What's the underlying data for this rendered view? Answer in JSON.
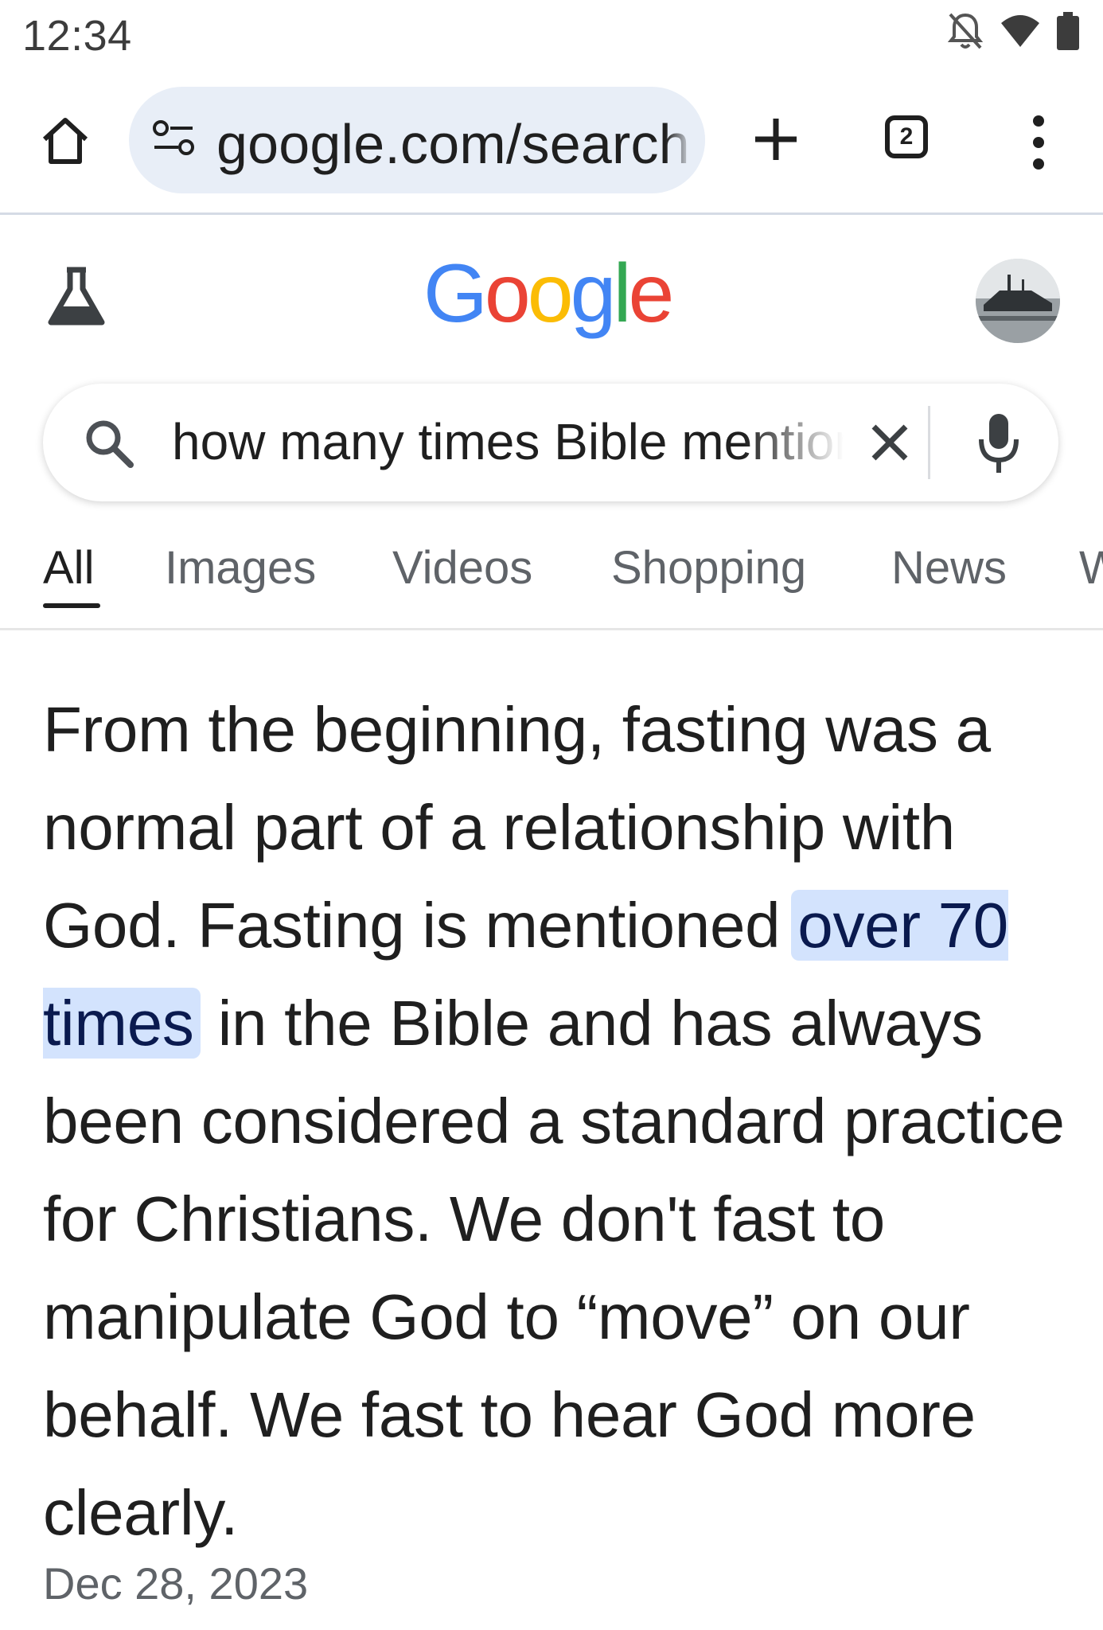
{
  "status_bar": {
    "time": "12:34",
    "icons": [
      "notifications-off-icon",
      "wifi-icon",
      "battery-icon"
    ]
  },
  "browser": {
    "url": "google.com/search",
    "tab_count": "2",
    "icons": [
      "home-icon",
      "site-settings-icon",
      "plus-icon",
      "tabs-icon",
      "more-vert-icon"
    ]
  },
  "google": {
    "logo_letters": [
      {
        "char": "G",
        "color": "#4285F4"
      },
      {
        "char": "o",
        "color": "#EA4335"
      },
      {
        "char": "o",
        "color": "#FBBC05"
      },
      {
        "char": "g",
        "color": "#4285F4"
      },
      {
        "char": "l",
        "color": "#34A853"
      },
      {
        "char": "e",
        "color": "#EA4335"
      }
    ]
  },
  "search": {
    "query": "how many times Bible mentions fasting"
  },
  "tabs": [
    "All",
    "Images",
    "Videos",
    "Shopping",
    "News",
    "W"
  ],
  "answer": {
    "before": "From the beginning, fasting was a normal part of a relationship with God. Fasting is mentioned ",
    "highlight": "over 70 times",
    "after": " in the Bible and has always been considered a standard practice for Christians. We don't fast to manipulate God to “move” on our behalf. We fast to hear God more clearly.",
    "date": "Dec 28, 2023"
  },
  "colors": {
    "omnibox_bg": "#e8eef7",
    "highlight_bg": "#d3e3fd",
    "text": "#1f1f1f",
    "muted": "#5f6368"
  }
}
